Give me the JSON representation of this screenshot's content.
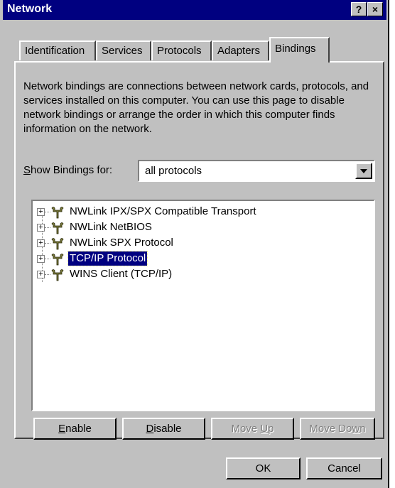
{
  "window": {
    "title": "Network",
    "help_label": "?",
    "close_label": "×"
  },
  "tabs": [
    {
      "label": "Identification",
      "active": false
    },
    {
      "label": "Services",
      "active": false
    },
    {
      "label": "Protocols",
      "active": false
    },
    {
      "label": "Adapters",
      "active": false
    },
    {
      "label": "Bindings",
      "active": true
    }
  ],
  "bindings": {
    "description": "Network bindings are connections between network cards, protocols, and services installed on this computer.  You can use this page to disable network bindings or arrange the order in which this computer finds information on the network.",
    "show_label_accel": "S",
    "show_label_rest": "how Bindings for:",
    "show_value": "all protocols",
    "tree": [
      {
        "label": "NWLink IPX/SPX Compatible Transport",
        "expander": "+",
        "icon": "protocol-icon",
        "selected": false
      },
      {
        "label": "NWLink NetBIOS",
        "expander": "+",
        "icon": "protocol-icon",
        "selected": false
      },
      {
        "label": "NWLink SPX Protocol",
        "expander": "+",
        "icon": "protocol-icon",
        "selected": false
      },
      {
        "label": "TCP/IP Protocol",
        "expander": "+",
        "icon": "protocol-icon",
        "selected": true
      },
      {
        "label": "WINS Client (TCP/IP)",
        "expander": "+",
        "icon": "protocol-icon",
        "selected": false
      }
    ],
    "buttons": {
      "enable": {
        "accel": "E",
        "rest": "nable",
        "enabled": true
      },
      "disable": {
        "accel": "D",
        "rest": "isable",
        "enabled": true
      },
      "move_up": {
        "pre": "Move ",
        "accel": "U",
        "rest": "p",
        "enabled": false
      },
      "move_down": {
        "pre": "Move Do",
        "accel": "w",
        "rest": "n",
        "enabled": false
      }
    }
  },
  "footer": {
    "ok_label": "OK",
    "cancel_label": "Cancel"
  },
  "colors": {
    "title_bar": "#000080",
    "face": "#c0c0c0",
    "selection": "#000080"
  }
}
